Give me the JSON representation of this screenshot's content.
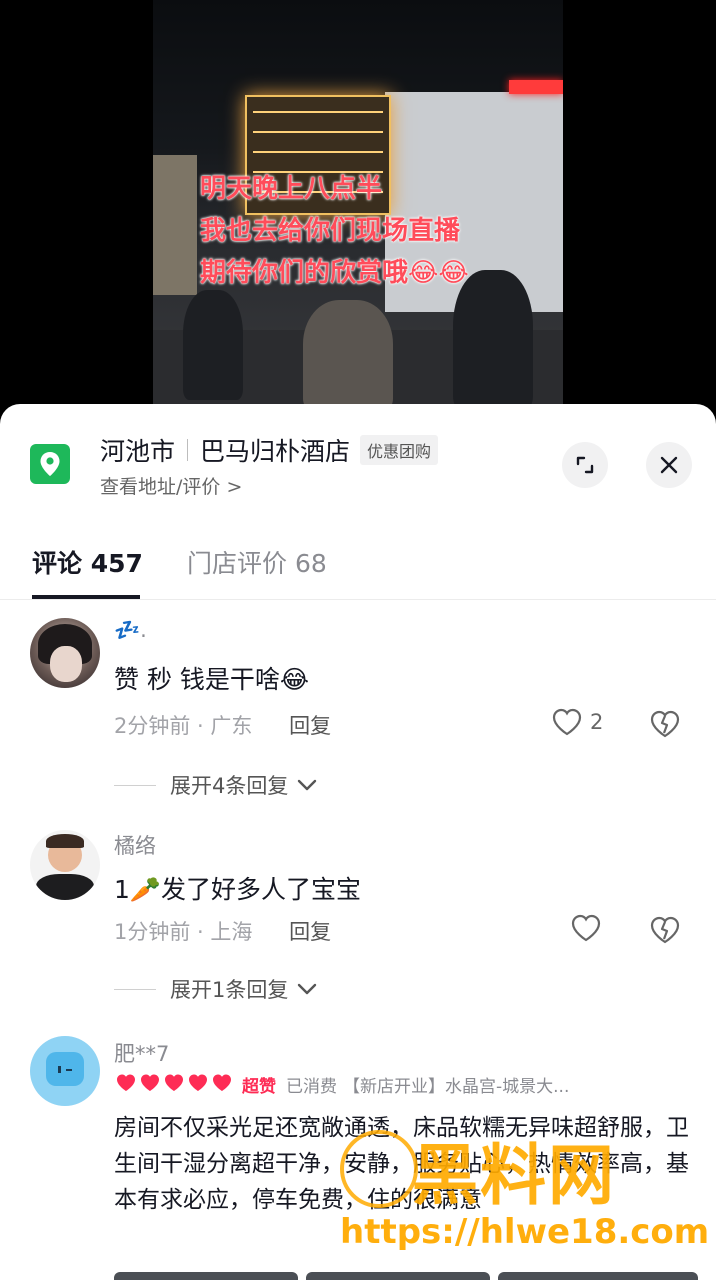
{
  "video": {
    "overlay_lines": [
      "明天晚上八点半",
      "我也去给你们现场直播",
      "期待你们的欣赏哦😂😂"
    ]
  },
  "poi": {
    "city": "河池市",
    "name": "巴马归朴酒店",
    "tag": "优惠团购",
    "subtitle": "查看地址/评价 >",
    "icons": {
      "pin": "location-pin-icon",
      "expand": "expand-icon",
      "close": "close-icon"
    },
    "colors": {
      "pin_bg": "#1EB85A"
    }
  },
  "tabs": [
    {
      "label": "评论 457",
      "active": true
    },
    {
      "label": "门店评价 68",
      "active": false
    }
  ],
  "comments": [
    {
      "username": "💤.",
      "text": "赞 秒  钱是干啥😂",
      "time_location": "2分钟前 · 广东",
      "reply_label": "回复",
      "likes": "2",
      "expand_label": "展开4条回复"
    },
    {
      "username": "橘络",
      "text": "1🥕发了好多人了宝宝",
      "time_location": "1分钟前 · 上海",
      "reply_label": "回复",
      "likes": "",
      "expand_label": "展开1条回复"
    }
  ],
  "review": {
    "username": "肥**7",
    "rating_hearts": 5,
    "rating_label": "超赞",
    "consumed": "已消费",
    "store_tag": "【新店开业】水晶宫-城景大...",
    "body": "房间不仅采光足还宽敞通透，床品软糯无异味超舒服，卫生间干湿分离超干净，安静，服务贴心，热情效率高，基本有求必应，停车免费，住的很满意",
    "colors": {
      "heart": "#FE2C55",
      "rating_label": "#FE2C55"
    }
  },
  "watermark": {
    "name": "黑料网",
    "url": "https://hlwe18.com"
  }
}
